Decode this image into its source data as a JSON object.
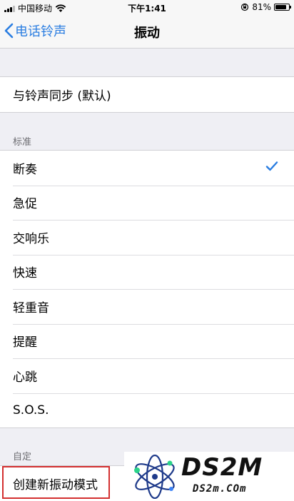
{
  "status_bar": {
    "carrier": "中国移动",
    "time": "下午1:41",
    "battery_percent": "81%",
    "battery_level": 0.81,
    "icons": [
      "signal-icon",
      "wifi-icon",
      "orientation-lock-icon",
      "battery-icon"
    ]
  },
  "nav": {
    "back_label": "电话铃声",
    "title": "振动"
  },
  "sync_group": {
    "item": "与铃声同步 (默认)"
  },
  "standard": {
    "header": "标准",
    "items": [
      "断奏",
      "急促",
      "交响乐",
      "快速",
      "轻重音",
      "提醒",
      "心跳",
      "S.O.S."
    ],
    "selected_index": 0
  },
  "custom": {
    "header": "自定",
    "create_label": "创建新振动模式"
  },
  "watermark": {
    "brand": "DS2M",
    "url": "DS2m.COm"
  },
  "colors": {
    "accent": "#2a7de1",
    "highlight": "#d32f2f",
    "background": "#efeff4"
  }
}
